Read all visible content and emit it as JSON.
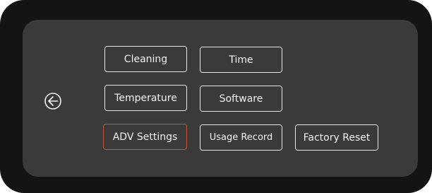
{
  "navigation": {
    "back_icon": "back-arrow-circle-icon"
  },
  "menu": {
    "cleaning": "Cleaning",
    "time": "Time",
    "temperature": "Temperature",
    "software": "Software",
    "adv_settings": "ADV Settings",
    "usage_record": "Usage Record",
    "factory_reset": "Factory Reset",
    "active_item": "ADV Settings"
  },
  "colors": {
    "bezel": "#141414",
    "screen": "#3a3a3a",
    "button_border": "#e6e6e6",
    "active_border": "#c4573a",
    "text": "#f4f4f4"
  }
}
